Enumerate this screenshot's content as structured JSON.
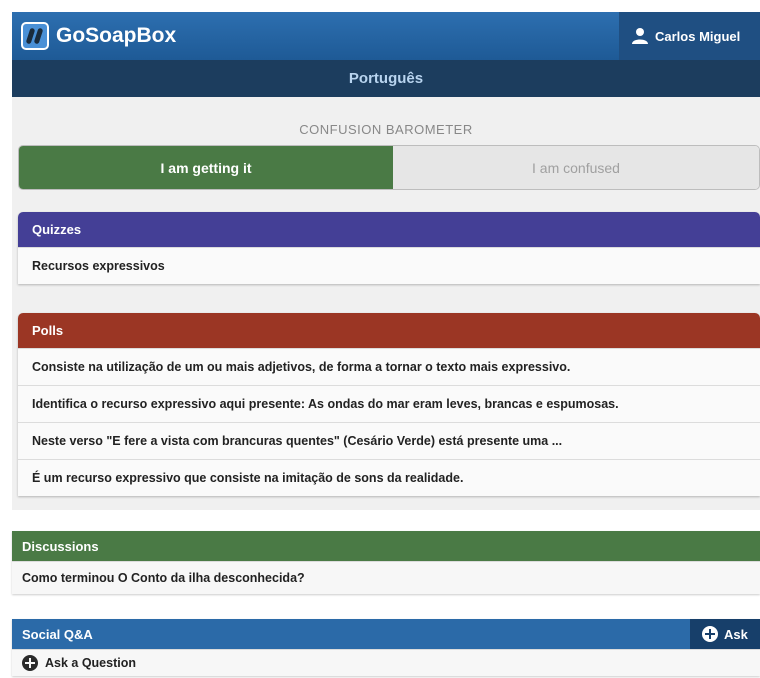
{
  "header": {
    "logo_text": "GoSoapBox",
    "user_name": "Carlos Miguel"
  },
  "subject": "Português",
  "barometer": {
    "label": "CONFUSION BAROMETER",
    "getting_it": "I am getting it",
    "confused": "I am confused"
  },
  "quizzes": {
    "title": "Quizzes",
    "items": [
      "Recursos expressivos"
    ]
  },
  "polls": {
    "title": "Polls",
    "items": [
      "Consiste na utilização de um ou mais adjetivos, de forma a tornar o texto mais expressivo.",
      "Identifica o recurso expressivo aqui presente: As ondas do mar eram leves, brancas e espumosas.",
      "Neste verso \"E fere a vista com brancuras quentes\" (Cesário Verde) está presente uma ...",
      "É um recurso expressivo que consiste na imitação de sons da realidade."
    ]
  },
  "discussions": {
    "title": "Discussions",
    "items": [
      "Como terminou O Conto da ilha desconhecida?"
    ]
  },
  "social_qa": {
    "title": "Social Q&A",
    "ask_button": "Ask",
    "ask_question": "Ask a Question"
  },
  "colors": {
    "header_blue": "#1e5a96",
    "subject_bar": "#1c3d5e",
    "getting_green": "#4a7a45",
    "quizzes_purple": "#443f96",
    "polls_red": "#9b3624",
    "discussions_green": "#4a7a45",
    "social_blue": "#2b6aa8"
  }
}
